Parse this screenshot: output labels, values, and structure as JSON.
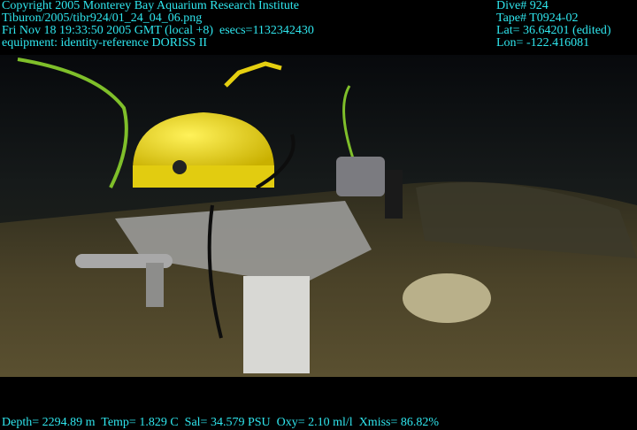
{
  "header_left": [
    "Copyright 2005 Monterey Bay Aquarium Research Institute",
    "Tiburon/2005/tibr924/01_24_04_06.png",
    "Fri Nov 18 19:33:50 2005 GMT (local +8)  esecs=1132342430",
    "equipment: identity-reference DORISS II"
  ],
  "header_right": [
    "Dive# 924",
    "Tape# T0924-02",
    "Lat= 36.64201 (edited)",
    "Lon= -122.416081"
  ],
  "footer": "Depth= 2294.89 m  Temp= 1.829 C  Sal= 34.579 PSU  Oxy= 2.10 ml/l  Xmiss= 86.82%",
  "colors": {
    "overlay_text": "#2fe6ee",
    "instrument": "#f2e01a",
    "seafloor": "#4a4228"
  }
}
